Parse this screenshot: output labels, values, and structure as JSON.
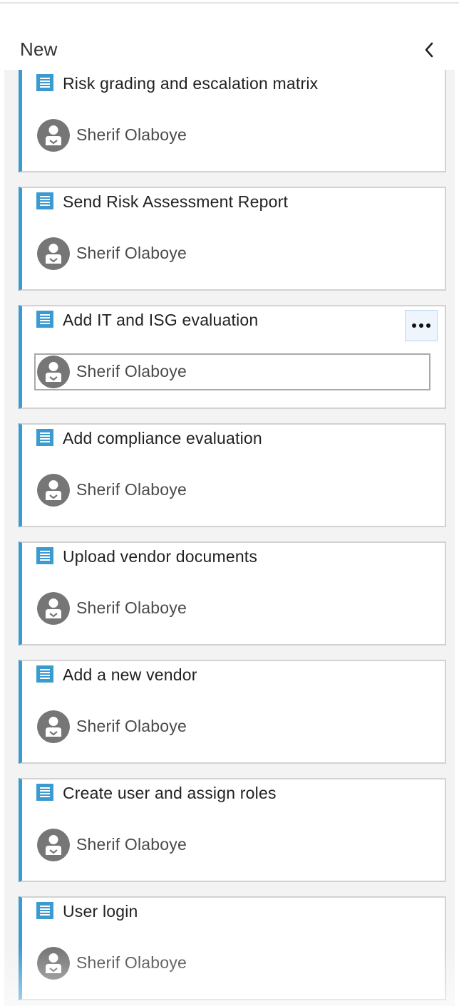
{
  "column": {
    "title": "New"
  },
  "cards": [
    {
      "title": "Risk grading and escalation matrix",
      "assignee": "Sherif Olaboye"
    },
    {
      "title": "Send Risk Assessment Report",
      "assignee": "Sherif Olaboye"
    },
    {
      "title": "Add IT and ISG evaluation",
      "assignee": "Sherif Olaboye"
    },
    {
      "title": "Add compliance evaluation",
      "assignee": "Sherif Olaboye"
    },
    {
      "title": "Upload vendor documents",
      "assignee": "Sherif Olaboye"
    },
    {
      "title": "Add a new vendor",
      "assignee": "Sherif Olaboye"
    },
    {
      "title": "Create user and assign roles",
      "assignee": "Sherif Olaboye"
    },
    {
      "title": "User login",
      "assignee": "Sherif Olaboye"
    }
  ],
  "icons": {
    "work_item": "work-item-icon",
    "avatar": "user-avatar-icon",
    "collapse": "chevron-left-icon",
    "more": "ellipsis-icon"
  },
  "colors": {
    "card_accent": "#3b9bd1",
    "icon_blue": "#3b9bd1",
    "avatar_gray": "#767676",
    "column_bg": "#f3f3f3",
    "card_border": "#d2d2d2"
  }
}
